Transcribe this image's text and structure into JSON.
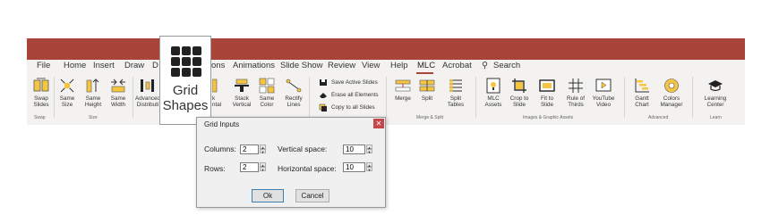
{
  "menu": {
    "items": [
      "File",
      "Home",
      "Insert",
      "Draw",
      "D",
      "ons",
      "Animations",
      "Slide Show",
      "Review",
      "View",
      "Help",
      "MLC",
      "Acrobat"
    ],
    "active": "MLC",
    "search_label": "Search"
  },
  "ribbon": {
    "commands": {
      "swap_slides": "Swap Slides",
      "same_size": "Same Size",
      "same_height": "Same Height",
      "same_width": "Same Width",
      "advanced_distribution": "Advanced Distributi",
      "stack_partial": "k",
      "stack_horizontal_partial": "ntal",
      "stack_vertical": "Stack Vertical",
      "same_color": "Same Color",
      "rectify_lines": "Rectify Lines",
      "save_active_slides": "Save Active Slides",
      "erase_all_elements": "Erase all Elements",
      "copy_to_all_slides": "Copy to all Slides",
      "merge": "Merge",
      "split": "Split",
      "split_tables": "Split Tables",
      "mlc_assets": "MLC Assets",
      "crop_to_slide": "Crop to Slide",
      "fit_to_slide": "Fit to Slide",
      "rule_of_thirds": "Rule of Thirds",
      "youtube_video": "YouTube Video",
      "gantt_chart": "Gantt Chart",
      "colors_manager": "Colors Manager",
      "learning_center": "Learning Center"
    },
    "groups": {
      "swap": "Swap",
      "size": "Size",
      "merge_split": "Merge & Split",
      "images_graphic_assets": "Images & Graphic Assets",
      "advanced": "Advanced",
      "learn": "Learn"
    },
    "grid_shapes_label": "Grid Shapes"
  },
  "dialog": {
    "title": "Grid Inputs",
    "columns_label": "Columns:",
    "columns_value": "2",
    "rows_label": "Rows:",
    "rows_value": "2",
    "vertical_space_label": "Vertical space:",
    "vertical_space_value": "10",
    "horizontal_space_label": "Horizontal space:",
    "horizontal_space_value": "10",
    "ok_label": "Ok",
    "cancel_label": "Cancel",
    "close_glyph": "✕"
  },
  "colors": {
    "accent": "#a8443a",
    "ribbon_bg": "#f3f2f1",
    "icon_gold": "#f5c542"
  }
}
